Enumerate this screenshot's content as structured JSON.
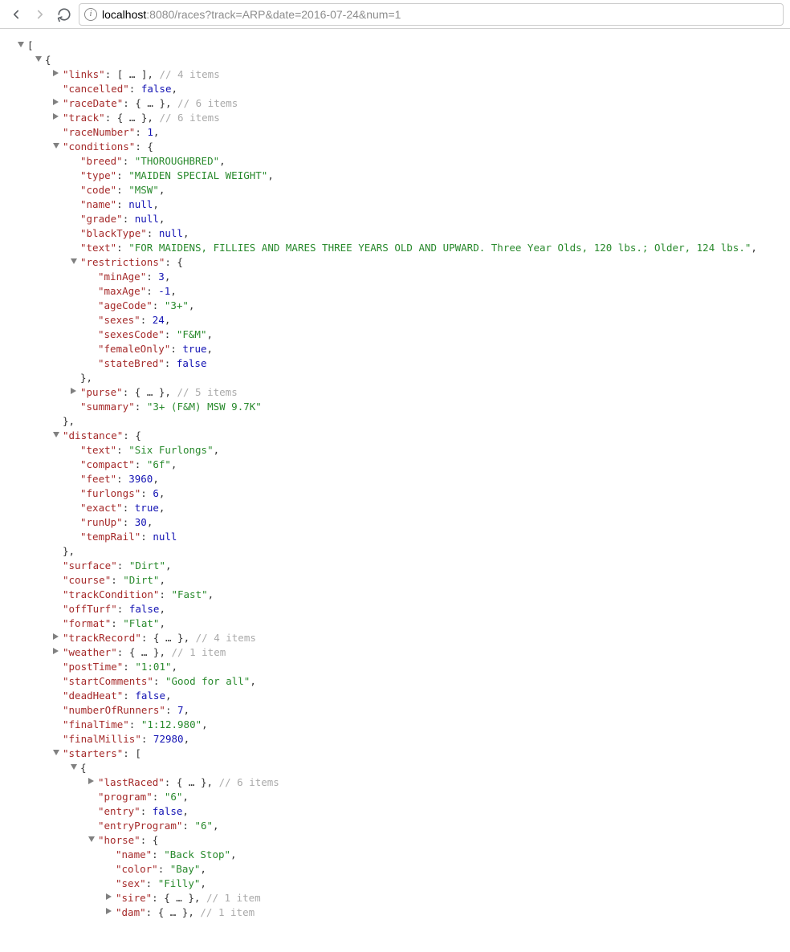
{
  "toolbar": {
    "host": "localhost",
    "rest": ":8080/races?track=ARP&date=2016-07-24&num=1"
  },
  "kv": {
    "links": {
      "key": "links",
      "stub": "[ … ]",
      "cmt": "// 4 items"
    },
    "cancelled": {
      "key": "cancelled",
      "val": "false",
      "type": "bool"
    },
    "raceDate": {
      "key": "raceDate",
      "stub": "{ … }",
      "cmt": "// 6 items"
    },
    "track": {
      "key": "track",
      "stub": "{ … }",
      "cmt": "// 6 items"
    },
    "raceNumber": {
      "key": "raceNumber",
      "val": "1",
      "type": "num"
    },
    "conditions": {
      "key": "conditions"
    },
    "breed": {
      "key": "breed",
      "val": "\"THOROUGHBRED\"",
      "type": "str"
    },
    "ctype": {
      "key": "type",
      "val": "\"MAIDEN SPECIAL WEIGHT\"",
      "type": "str"
    },
    "code": {
      "key": "code",
      "val": "\"MSW\"",
      "type": "str"
    },
    "cname": {
      "key": "name",
      "val": "null",
      "type": "null"
    },
    "grade": {
      "key": "grade",
      "val": "null",
      "type": "null"
    },
    "blackType": {
      "key": "blackType",
      "val": "null",
      "type": "null"
    },
    "ctext": {
      "key": "text",
      "val": "\"FOR MAIDENS, FILLIES AND MARES THREE YEARS OLD AND UPWARD. Three Year Olds, 120 lbs.; Older, 124 lbs.\"",
      "type": "str"
    },
    "restrictions": {
      "key": "restrictions"
    },
    "minAge": {
      "key": "minAge",
      "val": "3",
      "type": "num"
    },
    "maxAge": {
      "key": "maxAge",
      "val": "-1",
      "type": "num"
    },
    "ageCode": {
      "key": "ageCode",
      "val": "\"3+\"",
      "type": "str"
    },
    "sexes": {
      "key": "sexes",
      "val": "24",
      "type": "num"
    },
    "sexesCode": {
      "key": "sexesCode",
      "val": "\"F&M\"",
      "type": "str"
    },
    "femaleOnly": {
      "key": "femaleOnly",
      "val": "true",
      "type": "bool"
    },
    "stateBred": {
      "key": "stateBred",
      "val": "false",
      "type": "bool"
    },
    "purse": {
      "key": "purse",
      "stub": "{ … }",
      "cmt": "// 5 items"
    },
    "summary": {
      "key": "summary",
      "val": "\"3+ (F&M) MSW 9.7K\"",
      "type": "str"
    },
    "distance": {
      "key": "distance"
    },
    "dtext": {
      "key": "text",
      "val": "\"Six Furlongs\"",
      "type": "str"
    },
    "compact": {
      "key": "compact",
      "val": "\"6f\"",
      "type": "str"
    },
    "feet": {
      "key": "feet",
      "val": "3960",
      "type": "num"
    },
    "furlongs": {
      "key": "furlongs",
      "val": "6",
      "type": "num"
    },
    "exact": {
      "key": "exact",
      "val": "true",
      "type": "bool"
    },
    "runUp": {
      "key": "runUp",
      "val": "30",
      "type": "num"
    },
    "tempRail": {
      "key": "tempRail",
      "val": "null",
      "type": "null"
    },
    "surface": {
      "key": "surface",
      "val": "\"Dirt\"",
      "type": "str"
    },
    "course": {
      "key": "course",
      "val": "\"Dirt\"",
      "type": "str"
    },
    "trackCondition": {
      "key": "trackCondition",
      "val": "\"Fast\"",
      "type": "str"
    },
    "offTurf": {
      "key": "offTurf",
      "val": "false",
      "type": "bool"
    },
    "format": {
      "key": "format",
      "val": "\"Flat\"",
      "type": "str"
    },
    "trackRecord": {
      "key": "trackRecord",
      "stub": "{ … }",
      "cmt": "// 4 items"
    },
    "weather": {
      "key": "weather",
      "stub": "{ … }",
      "cmt": "// 1 item"
    },
    "postTime": {
      "key": "postTime",
      "val": "\"1:01\"",
      "type": "str"
    },
    "startComments": {
      "key": "startComments",
      "val": "\"Good for all\"",
      "type": "str"
    },
    "deadHeat": {
      "key": "deadHeat",
      "val": "false",
      "type": "bool"
    },
    "numberOfRunners": {
      "key": "numberOfRunners",
      "val": "7",
      "type": "num"
    },
    "finalTime": {
      "key": "finalTime",
      "val": "\"1:12.980\"",
      "type": "str"
    },
    "finalMillis": {
      "key": "finalMillis",
      "val": "72980",
      "type": "num"
    },
    "starters": {
      "key": "starters"
    },
    "lastRaced": {
      "key": "lastRaced",
      "stub": "{ … }",
      "cmt": "// 6 items"
    },
    "program": {
      "key": "program",
      "val": "\"6\"",
      "type": "str"
    },
    "entry": {
      "key": "entry",
      "val": "false",
      "type": "bool"
    },
    "entryProgram": {
      "key": "entryProgram",
      "val": "\"6\"",
      "type": "str"
    },
    "horse": {
      "key": "horse"
    },
    "hname": {
      "key": "name",
      "val": "\"Back Stop\"",
      "type": "str"
    },
    "color": {
      "key": "color",
      "val": "\"Bay\"",
      "type": "str"
    },
    "sex": {
      "key": "sex",
      "val": "\"Filly\"",
      "type": "str"
    },
    "sire": {
      "key": "sire",
      "stub": "{ … }",
      "cmt": "// 1 item"
    },
    "dam": {
      "key": "dam",
      "stub": "{ … }",
      "cmt": "// 1 item"
    }
  }
}
